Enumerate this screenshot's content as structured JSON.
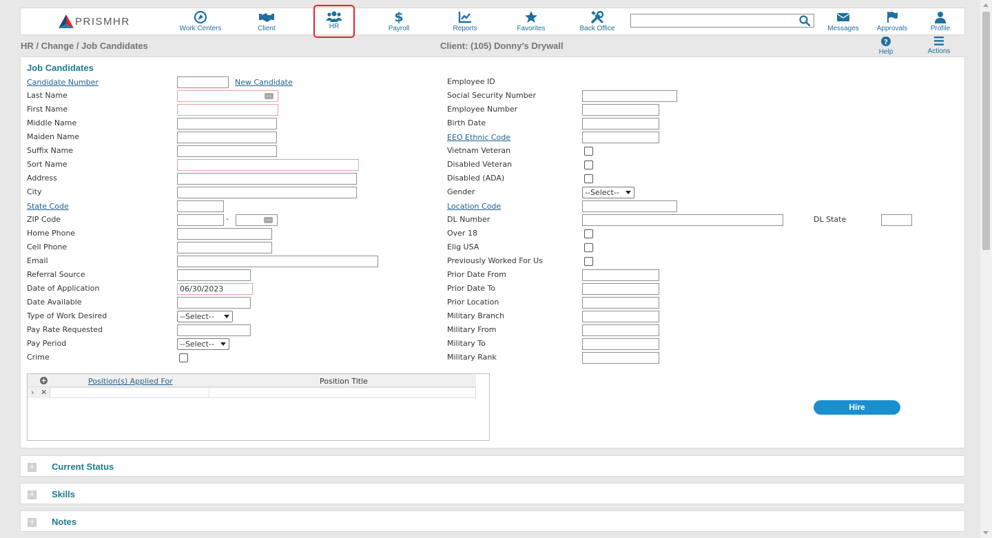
{
  "nav": {
    "brand": "PRISMHR",
    "items": [
      {
        "label": "Work Centers"
      },
      {
        "label": "Client"
      },
      {
        "label": "HR"
      },
      {
        "label": "Payroll"
      },
      {
        "label": "Reports"
      },
      {
        "label": "Favorites"
      },
      {
        "label": "Back Office"
      }
    ],
    "right": [
      {
        "label": "Messages"
      },
      {
        "label": "Approvals"
      },
      {
        "label": "Profile"
      }
    ],
    "search_value": ""
  },
  "breadcrumb": "HR / Change / Job Candidates",
  "client": "Client: (105) Donny's Drywall",
  "tools": {
    "help": "Help",
    "actions": "Actions"
  },
  "form": {
    "title": "Job Candidates",
    "left": {
      "candidate_number": "Candidate Number",
      "new_candidate": "New Candidate",
      "last_name": "Last Name",
      "first_name": "First Name",
      "middle_name": "Middle Name",
      "maiden_name": "Maiden Name",
      "suffix_name": "Suffix Name",
      "sort_name": "Sort Name",
      "address": "Address",
      "city": "City",
      "state_code": "State Code",
      "zip_code": "ZIP Code",
      "zip_sep": "-",
      "home_phone": "Home Phone",
      "cell_phone": "Cell Phone",
      "email": "Email",
      "referral_source": "Referral Source",
      "date_of_application": "Date of Application",
      "date_of_application_value": "06/30/2023",
      "date_available": "Date Available",
      "type_of_work": "Type of Work Desired",
      "type_of_work_value": "--Select--",
      "pay_rate": "Pay Rate Requested",
      "pay_period": "Pay Period",
      "pay_period_value": "--Select--",
      "crime": "Crime"
    },
    "right": {
      "employee_id": "Employee ID",
      "ssn": "Social Security Number",
      "employee_number": "Employee Number",
      "birth_date": "Birth Date",
      "eeo_ethnic": "EEO Ethnic Code",
      "vietnam_veteran": "Vietnam Veteran",
      "disabled_veteran": "Disabled Veteran",
      "disabled_ada": "Disabled (ADA)",
      "gender": "Gender",
      "gender_value": "--Select--",
      "location_code": "Location Code",
      "dl_number": "DL Number",
      "dl_state": "DL State",
      "over_18": "Over 18",
      "elig_usa": "Elig USA",
      "prev_worked": "Previously Worked For Us",
      "prior_date_from": "Prior Date From",
      "prior_date_to": "Prior Date To",
      "prior_location": "Prior Location",
      "military_branch": "Military Branch",
      "military_from": "Military From",
      "military_to": "Military To",
      "military_rank": "Military Rank"
    },
    "grid": {
      "col1": "Position(s) Applied For",
      "col2": "Position Title"
    },
    "hire": "Hire"
  },
  "sections": [
    {
      "title": "Current Status"
    },
    {
      "title": "Skills"
    },
    {
      "title": "Notes"
    }
  ]
}
